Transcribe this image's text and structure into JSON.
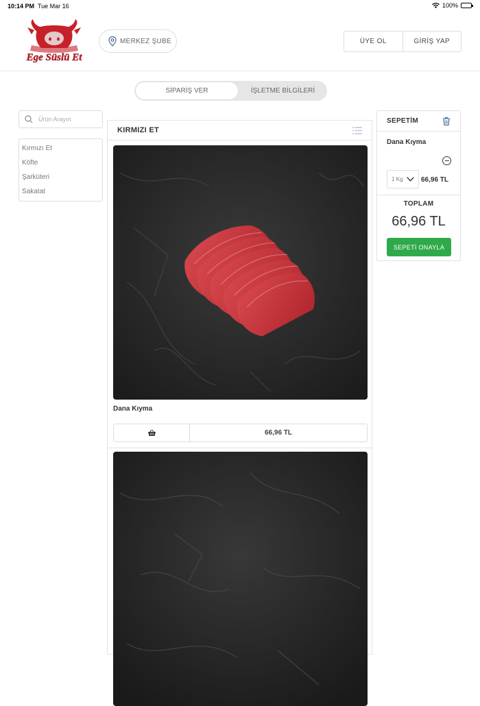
{
  "status_bar": {
    "time": "10:14 PM",
    "date": "Tue Mar 16",
    "battery": "100%"
  },
  "header": {
    "logo_text": "Ege Süslü Et",
    "branch_label": "MERKEZ ŞUBE",
    "register_label": "ÜYE OL",
    "login_label": "GİRİŞ YAP"
  },
  "segment": {
    "order_label": "SİPARİŞ VER",
    "info_label": "İŞLETME BİLGİLERİ"
  },
  "sidebar": {
    "search_placeholder": "Ürün Arayın",
    "categories": [
      "Kırmızı Et",
      "Köfte",
      "Şarküteri",
      "Sakatat"
    ]
  },
  "products": {
    "section_title": "KIRMIZI ET",
    "items": [
      {
        "name": "Dana Kıyma",
        "price": "66,96 TL"
      }
    ]
  },
  "basket": {
    "title": "SEPETİM",
    "item_name": "Dana Kıyma",
    "quantity": "1 Kg",
    "item_price": "66,96 TL",
    "total_label": "TOPLAM",
    "total_value": "66,96 TL",
    "confirm_label": "SEPETİ ONAYLA"
  },
  "colors": {
    "brand_red": "#c8202a",
    "confirm_green": "#2eaa4a"
  }
}
